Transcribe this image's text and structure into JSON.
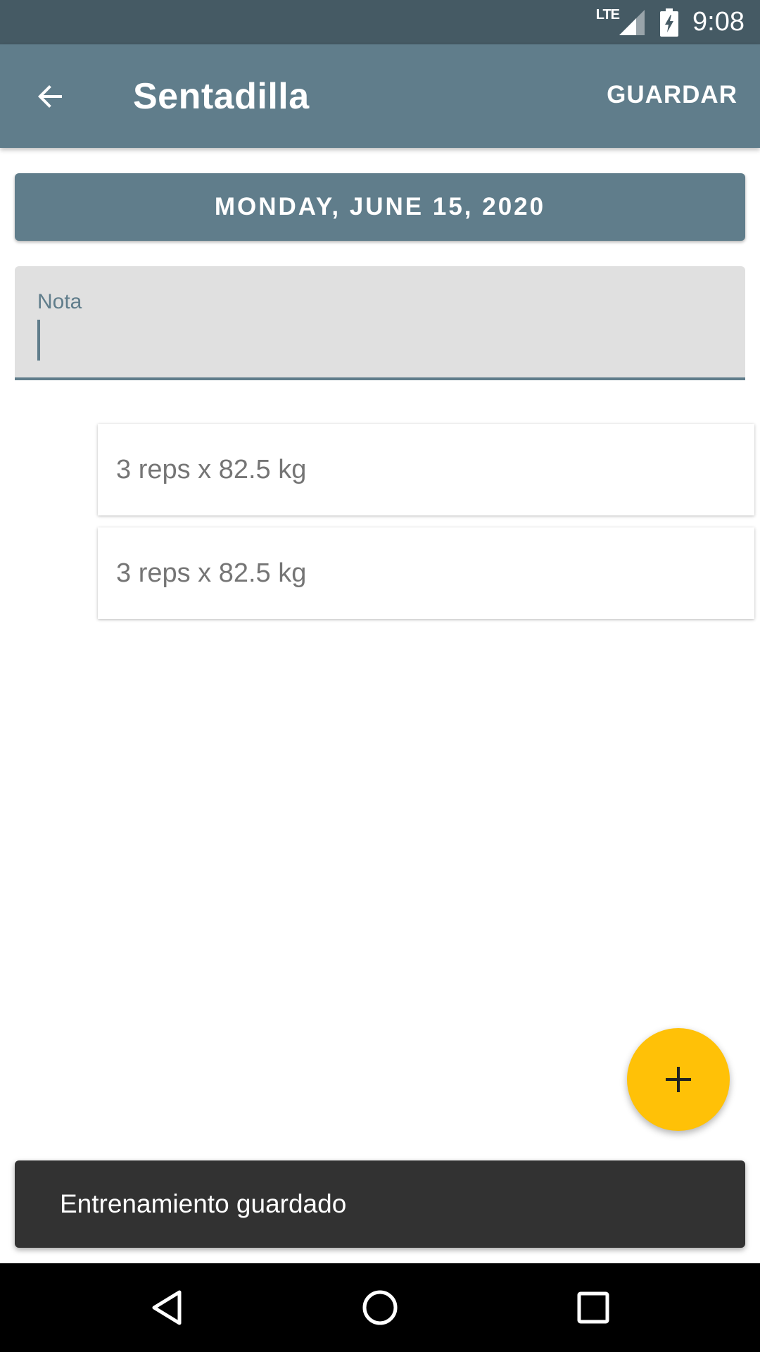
{
  "status_bar": {
    "network_label": "LTE",
    "time": "9:08"
  },
  "app_bar": {
    "title": "Sentadilla",
    "save_label": "GUARDAR"
  },
  "date_button": {
    "label": "MONDAY, JUNE 15, 2020"
  },
  "note_field": {
    "label": "Nota",
    "value": ""
  },
  "sets": [
    {
      "label": "3 reps x 82.5 kg"
    },
    {
      "label": "3 reps x 82.5 kg"
    }
  ],
  "snackbar": {
    "message": "Entrenamiento guardado"
  },
  "colors": {
    "primary": "#607d8b",
    "primary_dark": "#455a64",
    "accent": "#ffc107",
    "snackbar_bg": "#323232"
  },
  "icons": {
    "back": "arrow-left-icon",
    "fab": "plus-icon",
    "nav_back": "triangle-back-icon",
    "nav_home": "circle-home-icon",
    "nav_recents": "square-recents-icon"
  }
}
